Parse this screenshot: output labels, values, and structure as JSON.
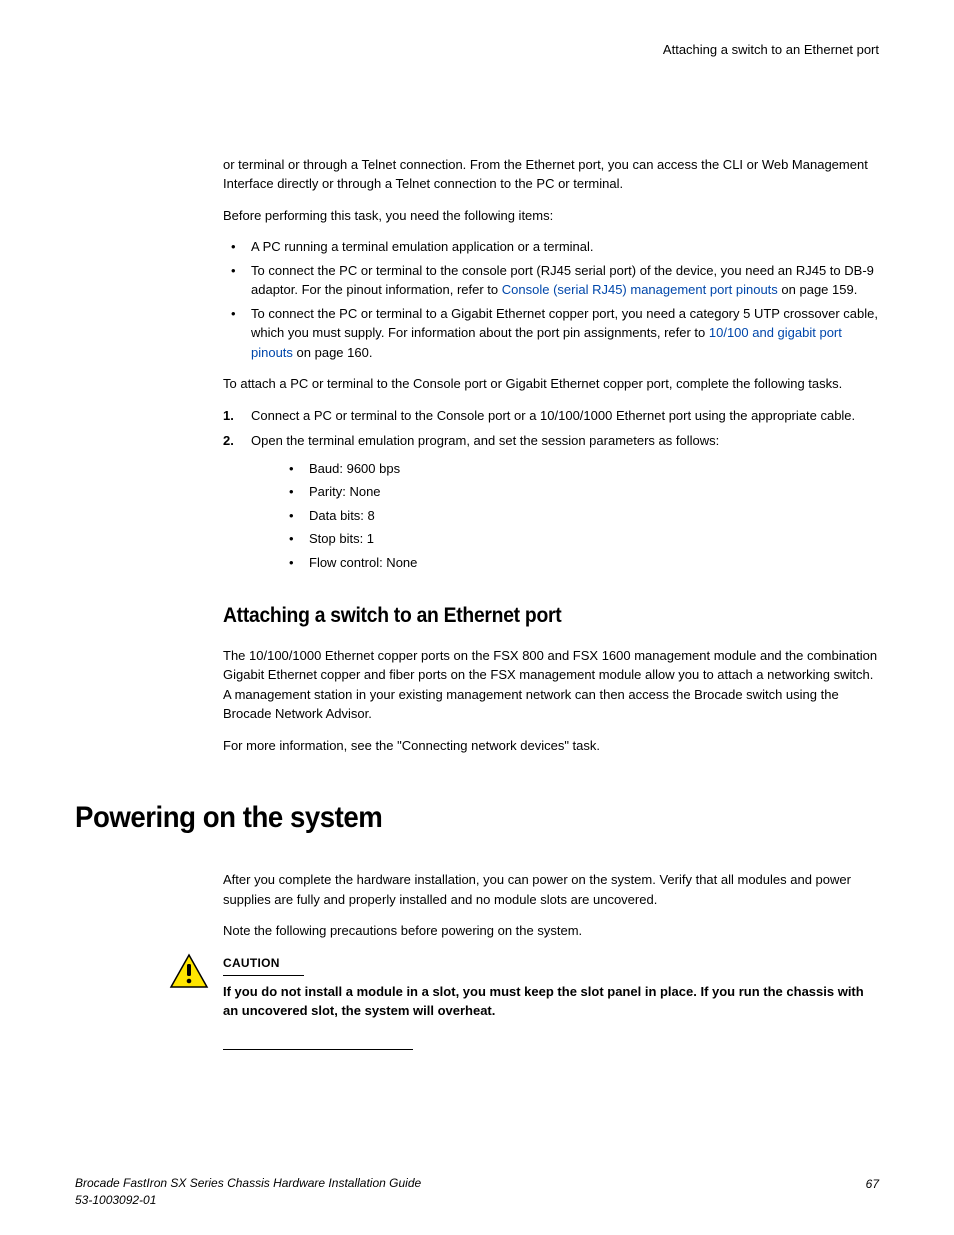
{
  "header": {
    "title": "Attaching a switch to an Ethernet port"
  },
  "intro_para": "or terminal or through a Telnet connection. From the Ethernet port, you can access the CLI or Web Management Interface directly or through a Telnet connection to the PC or terminal.",
  "before_para": "Before performing this task, you need the following items:",
  "req_list": {
    "item1": "A PC running a terminal emulation application or a terminal.",
    "item2_pre": "To connect the PC or terminal to the console port (RJ45 serial port) of the device, you need an RJ45 to DB-9 adaptor. For the pinout information, refer to ",
    "item2_link": "Console (serial RJ45) management port pinouts",
    "item2_post": " on page 159.",
    "item3_pre": "To connect the PC or terminal to a Gigabit Ethernet copper port, you need a category 5 UTP crossover cable, which you must supply. For information about the port pin assignments, refer to ",
    "item3_link": "10/100 and gigabit port pinouts",
    "item3_post": " on page 160."
  },
  "attach_para": "To attach a PC or terminal to the Console port or Gigabit Ethernet copper port, complete the following tasks.",
  "steps": {
    "s1_num": "1.",
    "s1": "Connect a PC or terminal to the Console port or a 10/100/1000 Ethernet port using the appropriate cable.",
    "s2_num": "2.",
    "s2": "Open the terminal emulation program, and set the session parameters as follows:",
    "params": {
      "p1": "Baud: 9600 bps",
      "p2": "Parity: None",
      "p3": "Data bits: 8",
      "p4": "Stop bits: 1",
      "p5": "Flow control: None"
    }
  },
  "section2": {
    "heading": "Attaching a switch to an Ethernet port",
    "para1": "The 10/100/1000 Ethernet copper ports on the FSX 800 and FSX 1600 management module and the combination Gigabit Ethernet copper and fiber ports on the FSX management module allow you to attach a networking switch. A management station in your existing management network can then access the Brocade switch using the Brocade Network Advisor.",
    "para2": "For more information, see the \"Connecting network devices\" task."
  },
  "section3": {
    "heading": "Powering on the system",
    "para1": "After you complete the hardware installation, you can power on the system. Verify that all modules and power supplies are fully and properly installed and no module slots are uncovered.",
    "para2": "Note the following precautions before powering on the system.",
    "caution_label": "CAUTION",
    "caution_text": "If you do not install a module in a slot, you must keep the slot panel in place. If you run the chassis with an uncovered slot, the system will overheat."
  },
  "footer": {
    "title": "Brocade FastIron SX Series Chassis Hardware Installation Guide",
    "docnum": "53-1003092-01",
    "page": "67"
  }
}
